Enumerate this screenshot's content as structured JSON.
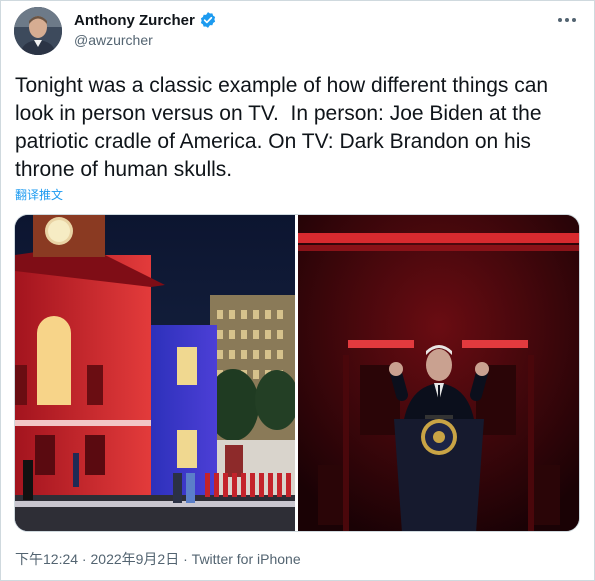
{
  "author": {
    "display_name": "Anthony Zurcher",
    "handle": "@awzurcher",
    "verified": true
  },
  "more_icon": "more-horizontal-icon",
  "tweet": {
    "text": "Tonight was a classic example of how different things can look in person versus on TV.  In person: Joe Biden at the patriotic cradle of America. On TV: Dark Brandon on his throne of human skulls.",
    "translate_link": "翻译推文"
  },
  "media": {
    "left_photo": "Independence Hall lit in red, white and blue with marching band",
    "right_photo": "Joe Biden speaking at presidential podium under dark red lighting"
  },
  "meta": {
    "time": "下午12:24",
    "separator": " · ",
    "date": "2022年9月2日",
    "source": "Twitter for iPhone"
  },
  "colors": {
    "link": "#1d9bf0",
    "secondary_text": "#536471",
    "verified": "#1d9bf0"
  }
}
